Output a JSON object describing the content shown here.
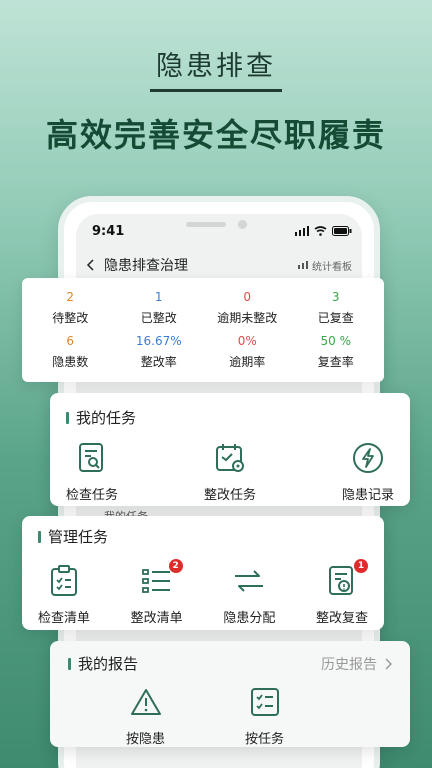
{
  "hero": {
    "tag": "隐患排查",
    "title": "高效完善安全尽职履责"
  },
  "phone": {
    "time": "9:41",
    "nav_title": "隐患排查治理",
    "nav_right": "统计看板"
  },
  "stats": [
    {
      "value": "2",
      "label": "待整改",
      "color": "#e0882b"
    },
    {
      "value": "1",
      "label": "已整改",
      "color": "#3a7fd6"
    },
    {
      "value": "0",
      "label": "逾期未整改",
      "color": "#e04b4b"
    },
    {
      "value": "3",
      "label": "已复查",
      "color": "#3aa64a"
    },
    {
      "value": "6",
      "label": "隐患数",
      "color": "#e0882b"
    },
    {
      "value": "16.67%",
      "label": "整改率",
      "color": "#3a7fd6"
    },
    {
      "value": "0%",
      "label": "逾期率",
      "color": "#e04b4b"
    },
    {
      "value": "50 %",
      "label": "复查率",
      "color": "#3aa64a"
    }
  ],
  "my_tasks": {
    "title": "我的任务",
    "items": [
      "检查任务",
      "整改任务",
      "隐患记录"
    ]
  },
  "peek_text": "我的任务",
  "mgmt_tasks": {
    "title": "管理任务",
    "items": [
      {
        "label": "检查清单",
        "badge": ""
      },
      {
        "label": "整改清单",
        "badge": "2"
      },
      {
        "label": "隐患分配",
        "badge": ""
      },
      {
        "label": "整改复查",
        "badge": "1"
      }
    ]
  },
  "reports": {
    "title": "我的报告",
    "history": "历史报告",
    "items": [
      "按隐患",
      "按任务"
    ]
  },
  "colors": {
    "accent": "#3b8a6d",
    "icon": "#2f6f57"
  }
}
